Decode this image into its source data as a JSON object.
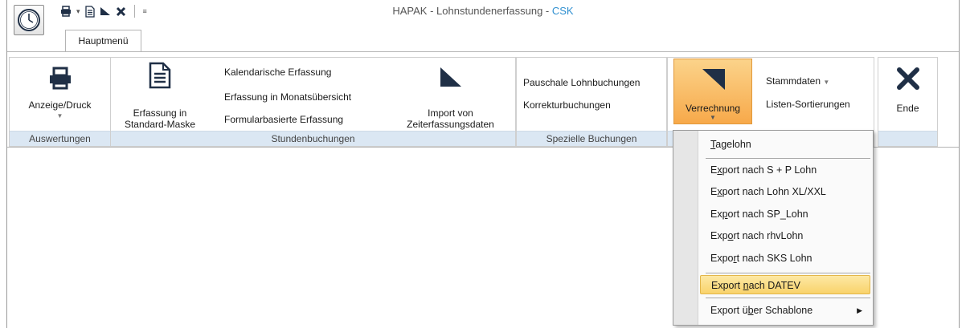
{
  "window": {
    "title_main": "HAPAK - Lohnstundenerfassung - ",
    "title_accent": "CSK"
  },
  "tabs": [
    {
      "label": "Hauptmenü"
    }
  ],
  "ribbon": {
    "auswertungen": {
      "label": "Auswertungen",
      "anzeige_druck": "Anzeige/Druck"
    },
    "stundenbuchungen": {
      "label": "Stundenbuchungen",
      "erfassung_line1": "Erfassung in",
      "erfassung_line2": "Standard-Maske",
      "kalendarisch": "Kalendarische Erfassung",
      "monatsuebersicht": "Erfassung in Monatsübersicht",
      "formularbasiert": "Formularbasierte Erfassung",
      "import_line1": "Import von",
      "import_line2": "Zeiterfassungsdaten"
    },
    "spezielle": {
      "label": "Spezielle Buchungen",
      "pauschale": "Pauschale Lohnbuchungen",
      "korrektur": "Korrekturbuchungen"
    },
    "verrechnung": {
      "label": "Verrechnung"
    },
    "extras": {
      "stammdaten": "Stammdaten",
      "sortierungen": "Listen-Sortierungen"
    },
    "ende": {
      "label": "Ende"
    }
  },
  "menu": {
    "items": [
      {
        "label": "Tagelohn",
        "key": "T",
        "rest": "agelohn",
        "pre": ""
      },
      {
        "label": "Export nach S + P Lohn",
        "pre": "E",
        "key": "x",
        "rest": "port nach S + P Lohn"
      },
      {
        "label": "Export nach Lohn XL/XXL",
        "pre": "E",
        "key": "x",
        "rest": "port nach Lohn XL/XXL"
      },
      {
        "label": "Export nach SP_Lohn",
        "pre": "Ex",
        "key": "p",
        "rest": "ort nach SP_Lohn"
      },
      {
        "label": "Export nach rhvLohn",
        "pre": "Exp",
        "key": "o",
        "rest": "rt nach rhvLohn"
      },
      {
        "label": "Export nach SKS Lohn",
        "pre": "Expo",
        "key": "r",
        "rest": "t nach SKS Lohn"
      },
      {
        "label": "Export nach DATEV",
        "pre": "Export ",
        "key": "n",
        "rest": "ach DATEV"
      },
      {
        "label": "Export über Schablone",
        "pre": "Export ü",
        "key": "b",
        "rest": "er Schablone"
      }
    ]
  },
  "colors": {
    "accent": "#2f8fd0",
    "highlight": "#f9d36b",
    "verrechnung_bg": "#f7a94a",
    "group_label_bg": "#dbe7f3",
    "icon_dark": "#1f2f46"
  }
}
